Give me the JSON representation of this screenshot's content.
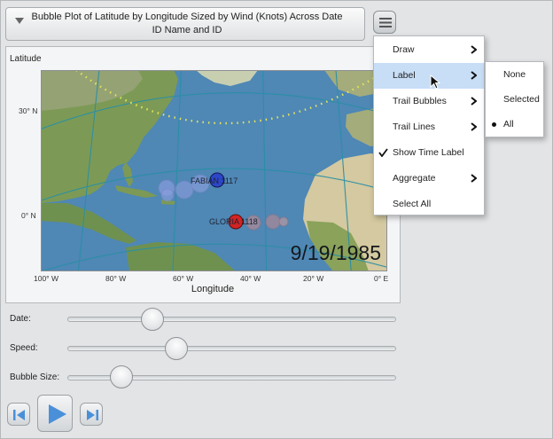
{
  "header": {
    "title": "Bubble Plot of Latitude by Longitude Sized by Wind (Knots) Across Date ID Name and ID",
    "menu_icon": "hamburger-icon"
  },
  "plot": {
    "y_axis_label": "Latitude",
    "x_axis_label": "Longitude",
    "y_ticks": [
      "30° N",
      "0° N"
    ],
    "x_ticks": [
      "100° W",
      "80° W",
      "60° W",
      "40° W",
      "20° W",
      "0° E"
    ],
    "date_label": "9/19/1985",
    "bubbles": [
      {
        "label": "FABIAN 1117",
        "color": "#2c46c9"
      },
      {
        "label": "GLORIA 1118",
        "color": "#d42323"
      }
    ]
  },
  "controls": {
    "date_label": "Date:",
    "speed_label": "Speed:",
    "bubble_size_label": "Bubble Size:",
    "date_value": 0.24,
    "speed_value": 0.32,
    "bubble_size_value": 0.14,
    "step_back_icon": "step-back-icon",
    "play_icon": "play-icon",
    "step_forward_icon": "step-forward-icon"
  },
  "menu": {
    "items": [
      {
        "label": "Draw",
        "submenu": true
      },
      {
        "label": "Label",
        "submenu": true,
        "highlighted": true
      },
      {
        "label": "Trail Bubbles",
        "submenu": true
      },
      {
        "label": "Trail Lines",
        "submenu": true
      },
      {
        "label": "Show Time Label",
        "checked": true
      },
      {
        "label": "Aggregate",
        "submenu": true
      },
      {
        "label": "Select All"
      }
    ],
    "label_submenu": [
      {
        "label": "None"
      },
      {
        "label": "Selected"
      },
      {
        "label": "All",
        "selected": true
      }
    ]
  },
  "colors": {
    "ocean": "#4f87b5",
    "grid_lines": "#2a8fa6",
    "highlight": "#c8ddf6",
    "fabian": "#2c46c9",
    "gloria": "#d42323"
  }
}
